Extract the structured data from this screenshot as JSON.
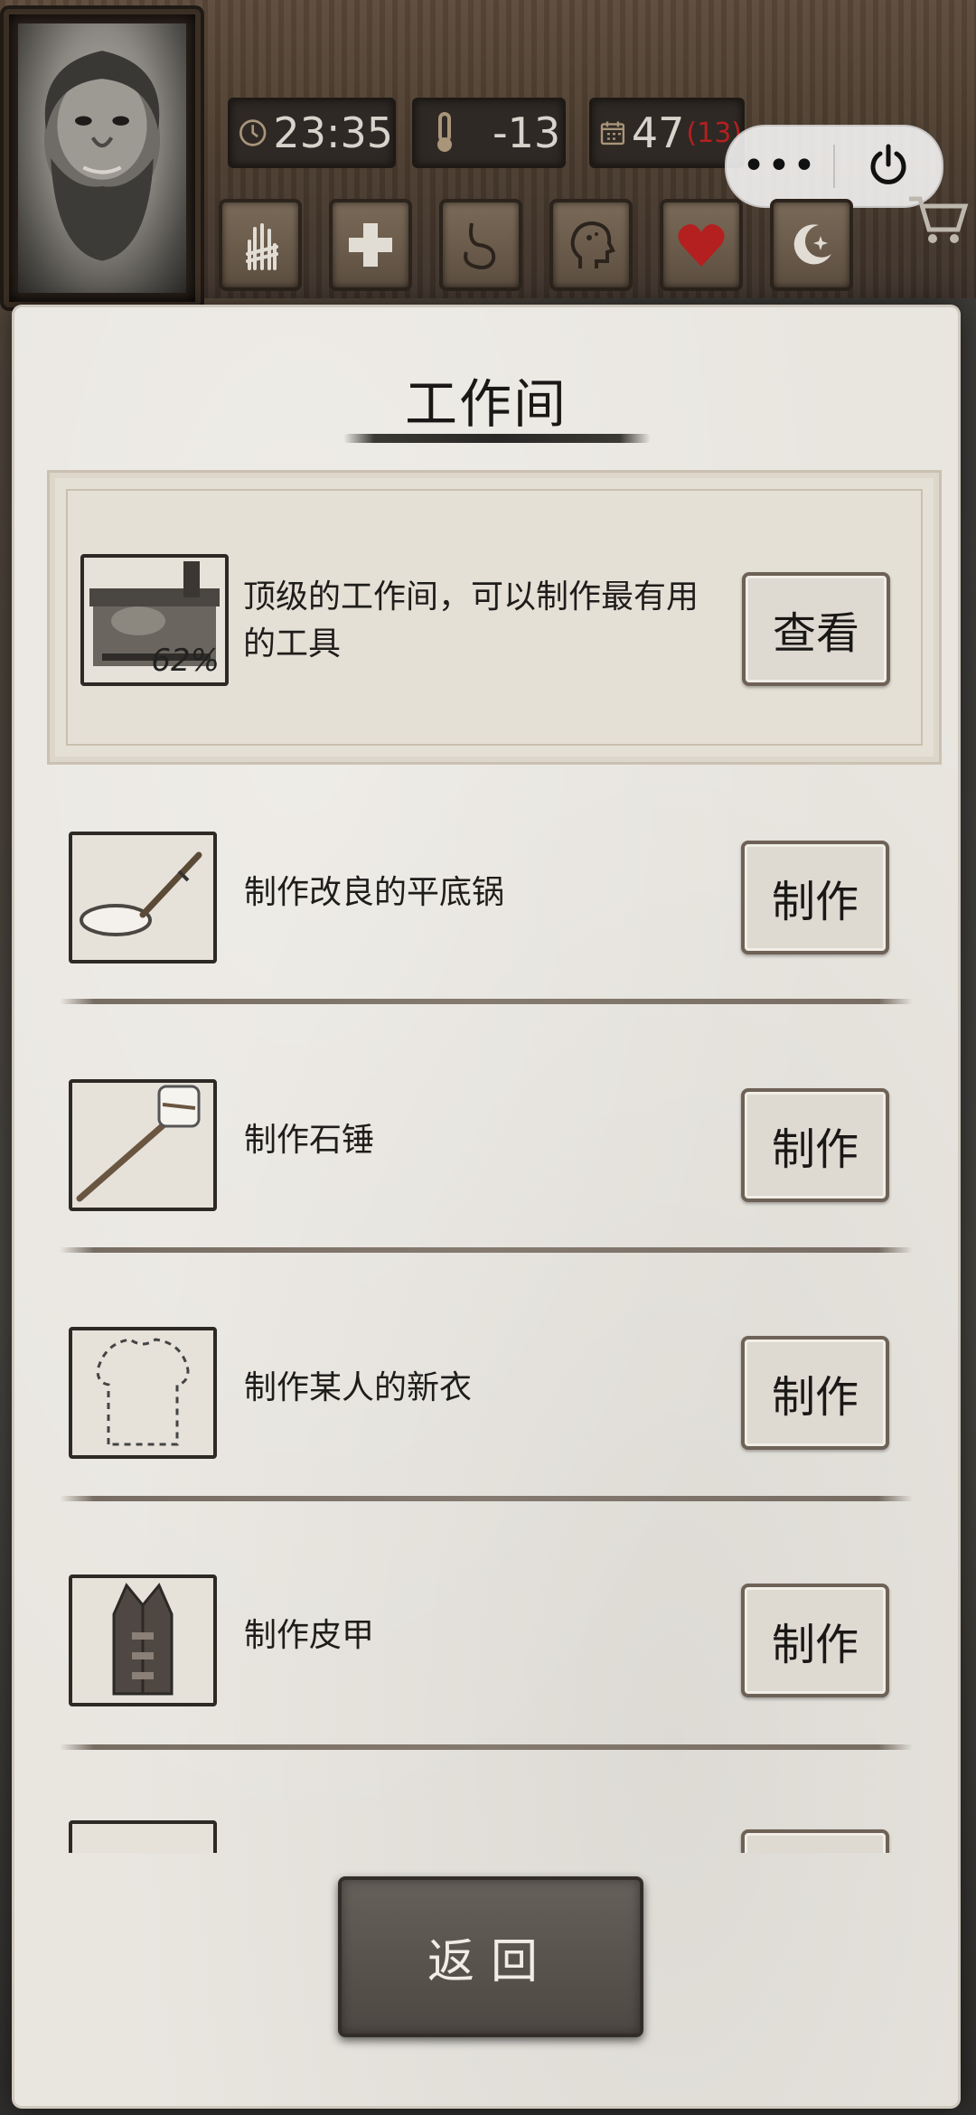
{
  "status": {
    "time": "23:35",
    "temperature": "-13",
    "day": "47",
    "day_sub": "(13)"
  },
  "capsule": {
    "more_icon": "ellipsis-icon",
    "close_icon": "power-icon"
  },
  "quick_actions": [
    {
      "name": "hand",
      "icon": "bandaged-hand-icon"
    },
    {
      "name": "health",
      "icon": "medical-cross-icon"
    },
    {
      "name": "stomach",
      "icon": "stomach-icon"
    },
    {
      "name": "mind",
      "icon": "head-icon"
    },
    {
      "name": "heart",
      "icon": "heart-icon",
      "color": "#b3201f"
    },
    {
      "name": "sleep",
      "icon": "moon-icon"
    }
  ],
  "panel": {
    "title": "工作间"
  },
  "featured": {
    "description_line1": "顶级的工作间，可以制作最有用",
    "description_line2": "的工具",
    "progress": "62%",
    "button_label": "查看"
  },
  "recipes": [
    {
      "label": "制作改良的平底锅",
      "button_label": "制作"
    },
    {
      "label": "制作石锤",
      "button_label": "制作"
    },
    {
      "label": "制作某人的新衣",
      "button_label": "制作"
    },
    {
      "label": "制作皮甲",
      "button_label": "制作"
    }
  ],
  "footer": {
    "back_label": "返回"
  }
}
